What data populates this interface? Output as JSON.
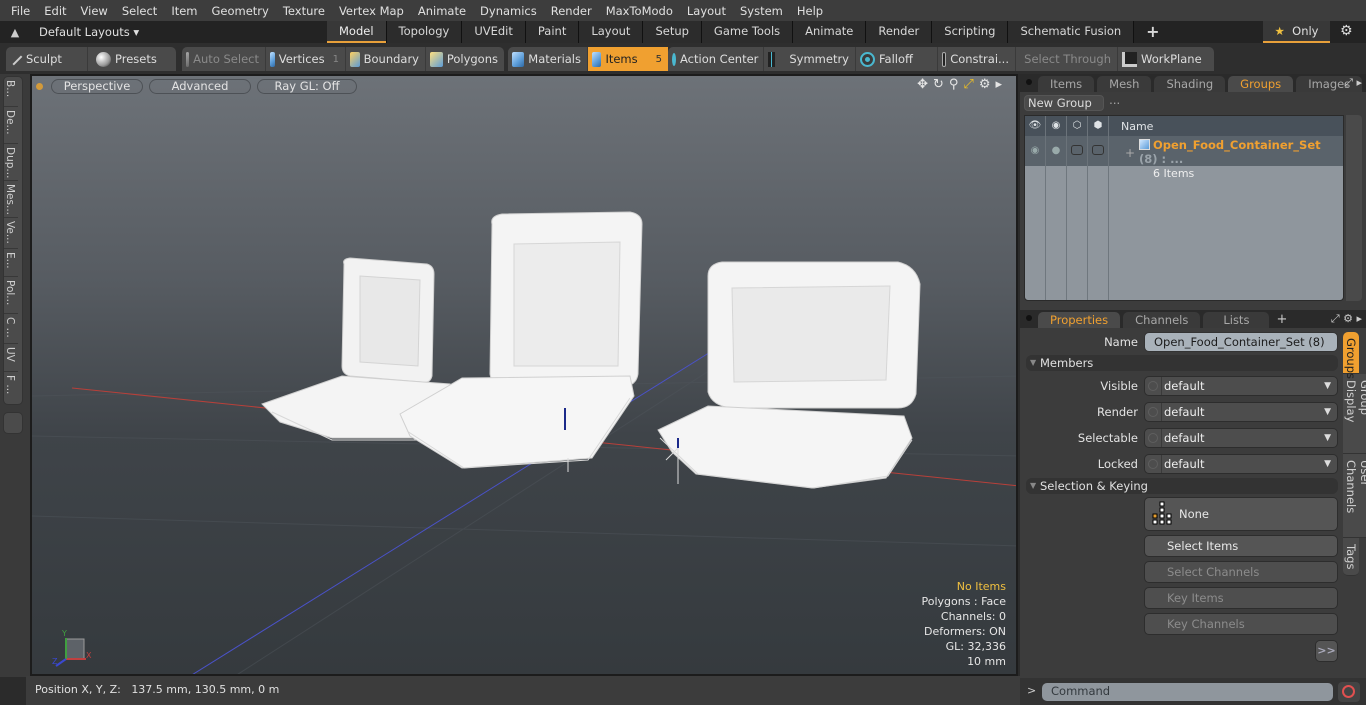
{
  "menubar": {
    "items": [
      "File",
      "Edit",
      "View",
      "Select",
      "Item",
      "Geometry",
      "Texture",
      "Vertex Map",
      "Animate",
      "Dynamics",
      "Render",
      "MaxToModo",
      "Layout",
      "System",
      "Help"
    ]
  },
  "layoutbar": {
    "layouts_label": "Default Layouts",
    "tabs": [
      {
        "label": "Model",
        "active": true
      },
      {
        "label": "Topology"
      },
      {
        "label": "UVEdit"
      },
      {
        "label": "Paint"
      },
      {
        "label": "Layout"
      },
      {
        "label": "Setup"
      },
      {
        "label": "Game Tools"
      },
      {
        "label": "Animate"
      },
      {
        "label": "Render"
      },
      {
        "label": "Scripting"
      },
      {
        "label": "Schematic Fusion"
      }
    ],
    "add_tab": "+",
    "only_label": "Only",
    "star": "★"
  },
  "toolbar": {
    "sculpt": "Sculpt",
    "presets": "Presets",
    "auto_select": "Auto Select",
    "vertices": "Vertices",
    "vertices_count": "1",
    "boundary": "Boundary",
    "polygons": "Polygons",
    "materials": "Materials",
    "items": "Items",
    "items_count": "5",
    "action_center": "Action Center",
    "symmetry": "Symmetry",
    "falloff": "Falloff",
    "constraints": "Constrai...",
    "select_through": "Select Through",
    "workplane": "WorkPlane"
  },
  "leftstrip": {
    "tabs": [
      "B...",
      "De...",
      "Dup...",
      "Mes...",
      "Ve...",
      "E...",
      "Pol...",
      "C ...",
      "UV",
      "F ..."
    ]
  },
  "viewport": {
    "view_mode": "Perspective",
    "shading": "Advanced",
    "raygl": "Ray GL: Off",
    "stats": {
      "selection": "No Items",
      "polygons": "Polygons : Face",
      "channels": "Channels: 0",
      "deformers": "Deformers: ON",
      "gl": "GL: 32,336",
      "scale": "10 mm"
    },
    "axis_labels": {
      "x": "X",
      "y": "Y",
      "z": "Z"
    }
  },
  "statusbar": {
    "position_label": "Position X, Y, Z:",
    "position_value": "137.5 mm, 130.5 mm, 0 m"
  },
  "top_panel": {
    "tabs": [
      {
        "label": "Items"
      },
      {
        "label": "Mesh ..."
      },
      {
        "label": "Shading"
      },
      {
        "label": "Groups",
        "active": true
      },
      {
        "label": "Images"
      }
    ],
    "new_group": "New Group",
    "column_name": "Name",
    "groups": [
      {
        "name": "Open_Food_Container_Set",
        "count": "(8)",
        "suffix": ": ...",
        "subtitle": "6 Items"
      }
    ]
  },
  "properties_panel": {
    "tabs": [
      {
        "label": "Properties",
        "active": true
      },
      {
        "label": "Channels"
      },
      {
        "label": "Lists"
      }
    ],
    "name_label": "Name",
    "name_value": "Open_Food_Container_Set (8)",
    "members_section": "Members",
    "fields": [
      {
        "label": "Visible",
        "value": "default"
      },
      {
        "label": "Render",
        "value": "default"
      },
      {
        "label": "Selectable",
        "value": "default"
      },
      {
        "label": "Locked",
        "value": "default"
      }
    ],
    "selection_section": "Selection & Keying",
    "none_button": "None",
    "select_items": "Select Items",
    "select_channels": "Select Channels",
    "key_items": "Key Items",
    "key_channels": "Key Channels",
    "more": ">>",
    "side_tabs": [
      {
        "label": "Groups",
        "active": true
      },
      {
        "label": "Group Display"
      },
      {
        "label": "User Channels"
      },
      {
        "label": "Tags"
      }
    ]
  },
  "command": {
    "prompt": ">",
    "placeholder": "Command"
  },
  "colors": {
    "accent": "#f0a030",
    "selection_warning": "#f0c040",
    "x_axis": "#c0403a",
    "z_axis": "#4a52c8"
  }
}
